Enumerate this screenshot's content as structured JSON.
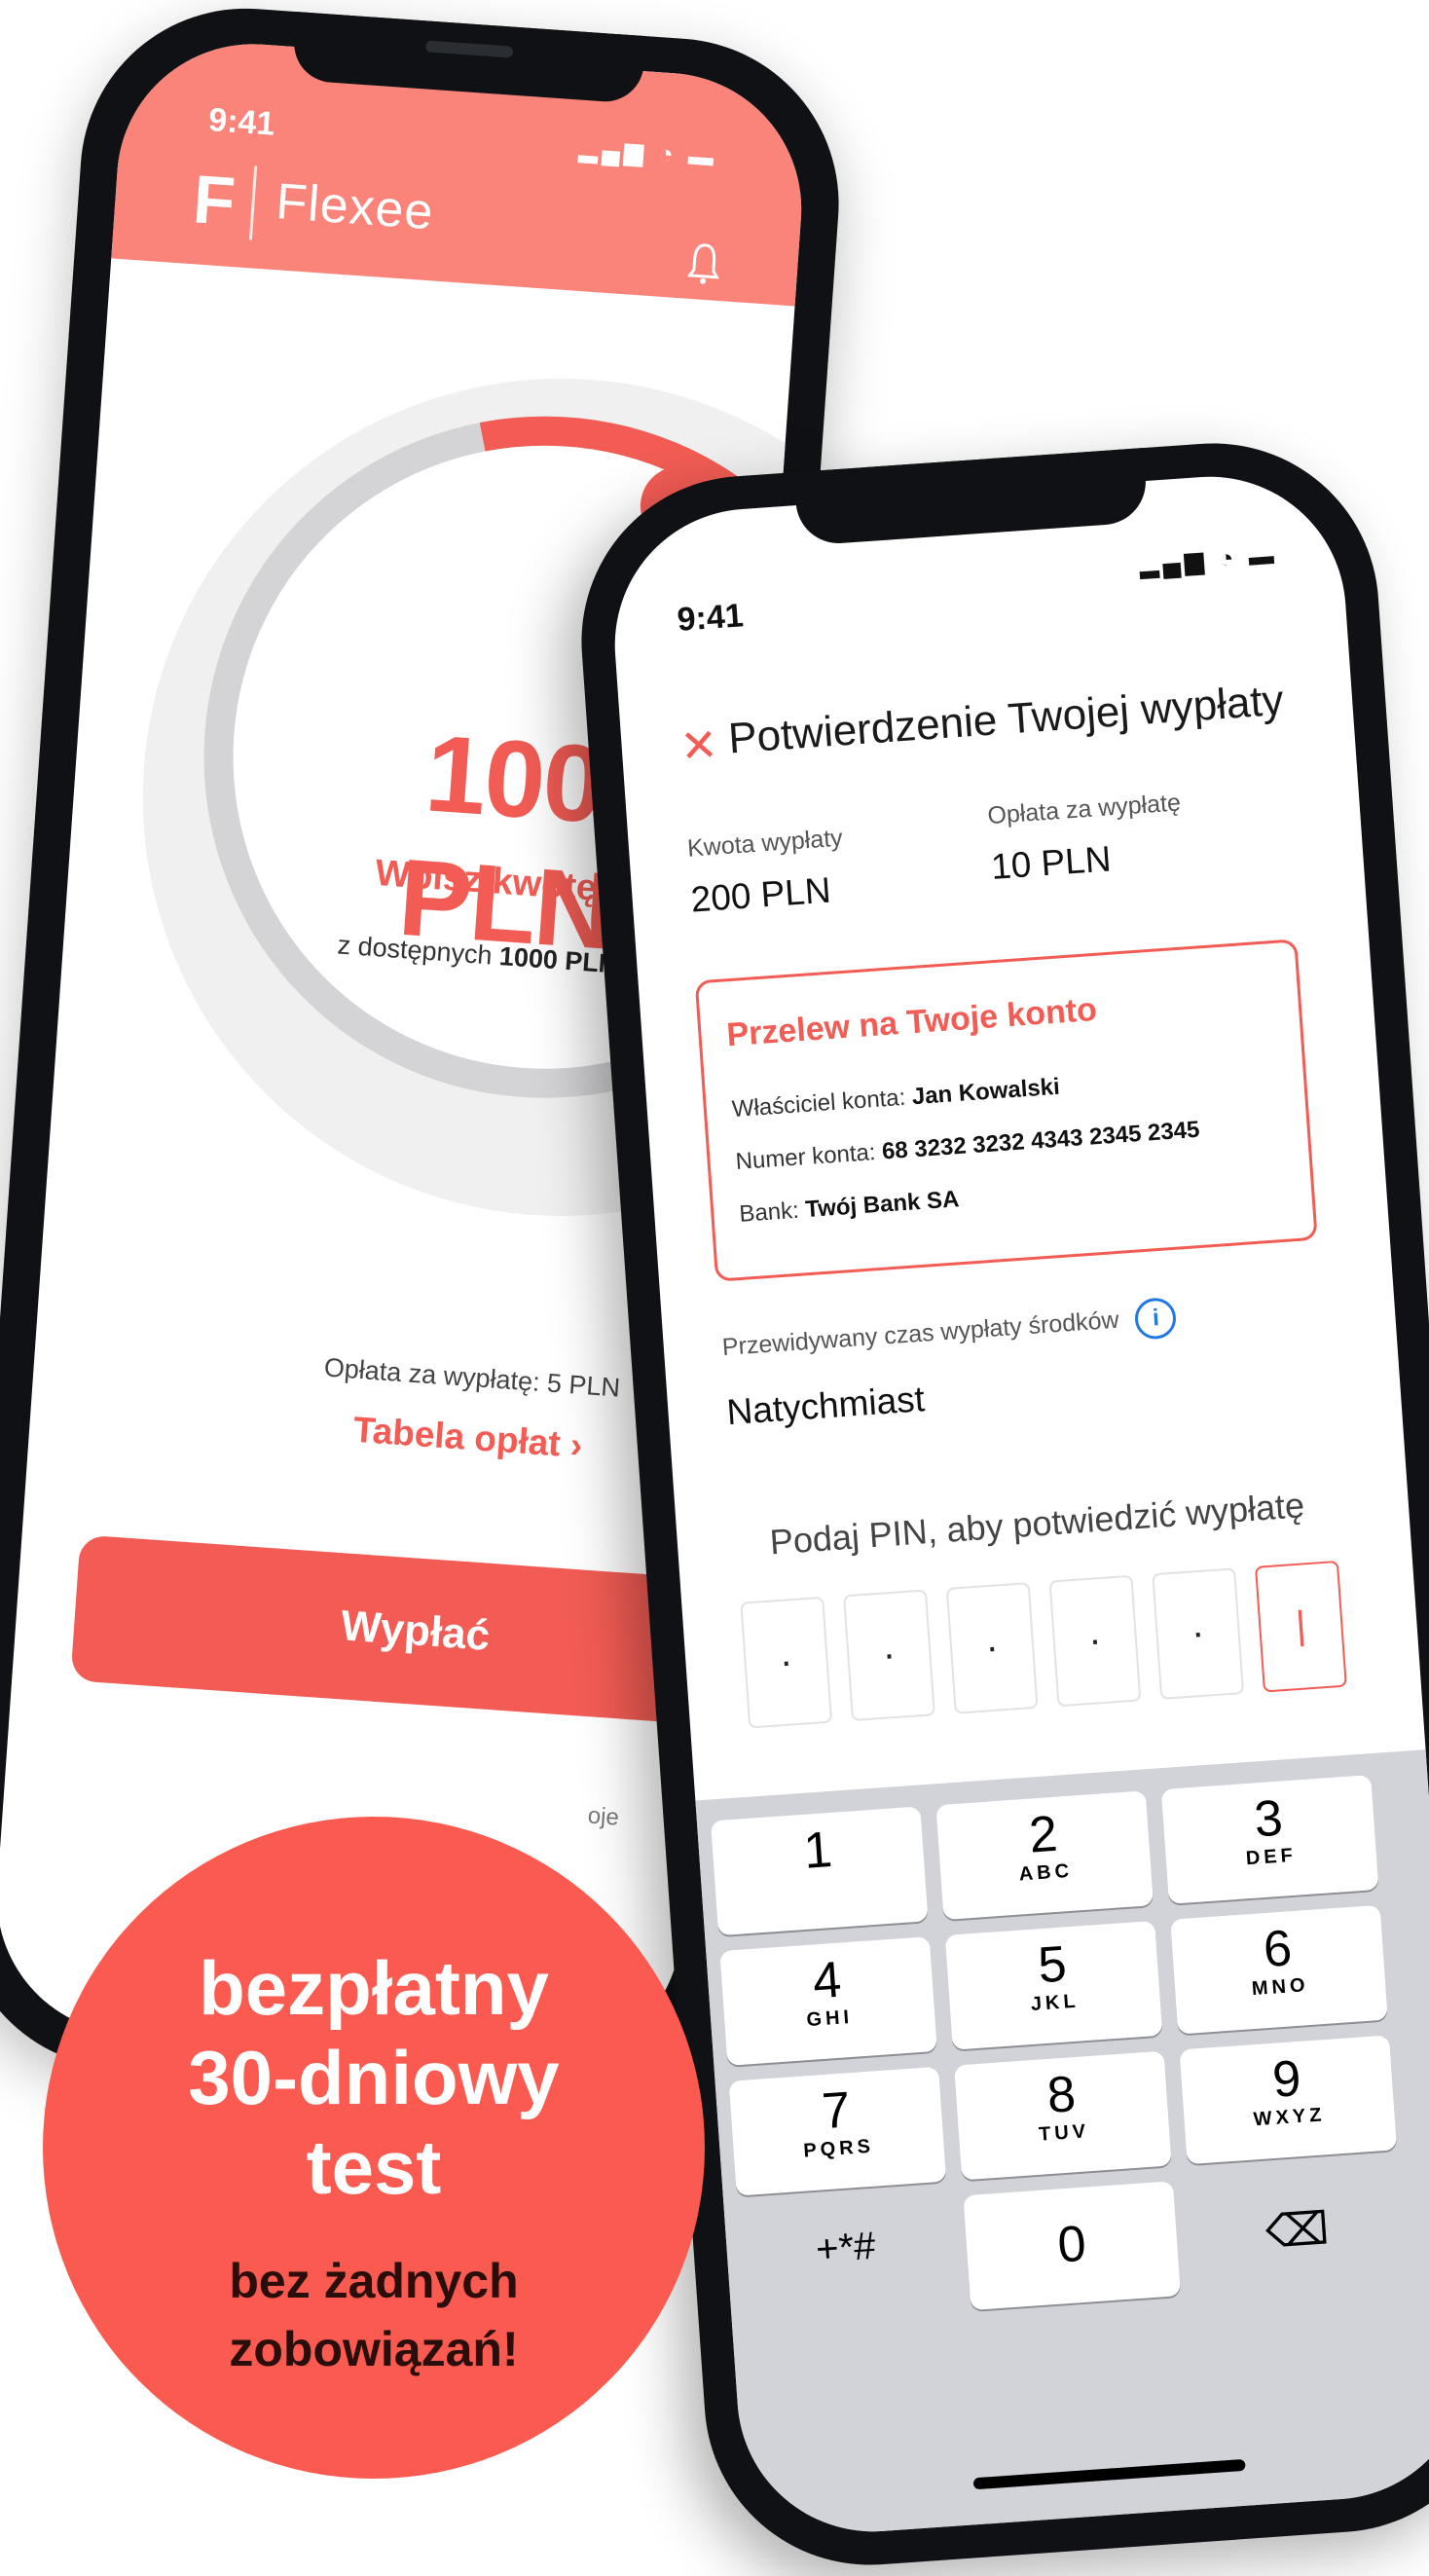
{
  "back_phone": {
    "time": "9:41",
    "status_icons": "▂▄▆ ◔ ▬",
    "logo_mark": "F",
    "brand": "Flexee",
    "amount": "100 PLN",
    "enter_amount_label": "Wpisz kwotę ✎",
    "available_prefix": "z dostępnych",
    "available_value": "1000 PLN",
    "info_symbol": "i",
    "fee_text": "Opłata za wypłatę: 5 PLN",
    "fee_table_link": "Tabela opłat ›",
    "withdraw_button": "Wypłać",
    "nav_partial_label": "oje",
    "dial_handle_symbol": "⌟",
    "accent_color": "#f25c54",
    "header_color": "#fa8479",
    "icons": [
      "bell-icon",
      "info-icon",
      "edit-icon",
      "chevron-right-icon"
    ]
  },
  "front_phone": {
    "time": "9:41",
    "status_icons": "▂▄▆ ◔ ▬",
    "close_symbol": "✕",
    "title": "Potwierdzenie Twojej wypłaty",
    "amount_label": "Kwota wypłaty",
    "amount_value": "200 PLN",
    "fee_label": "Opłata za wypłatę",
    "fee_value": "10 PLN",
    "transfer": {
      "title": "Przelew na Twoje konto",
      "owner_label": "Właściciel konta:",
      "owner_value": "Jan Kowalski",
      "account_label": "Numer konta:",
      "account_value": "68 3232 3232 4343 2345 2345",
      "bank_label": "Bank:",
      "bank_value": "Twój Bank SA"
    },
    "time_label": "Przewidywany czas wypłaty środków",
    "time_value": "Natychmiast",
    "pin_prompt": "Podaj PIN, aby potwiedzić wypłatę",
    "pin_digits": [
      "·",
      "·",
      "·",
      "·",
      "·",
      "|"
    ],
    "keypad": [
      {
        "digit": "1",
        "letters": ""
      },
      {
        "digit": "2",
        "letters": "ABC"
      },
      {
        "digit": "3",
        "letters": "DEF"
      },
      {
        "digit": "4",
        "letters": "GHI"
      },
      {
        "digit": "5",
        "letters": "JKL"
      },
      {
        "digit": "6",
        "letters": "MNO"
      },
      {
        "digit": "7",
        "letters": "PQRS"
      },
      {
        "digit": "8",
        "letters": "TUV"
      },
      {
        "digit": "9",
        "letters": "WXYZ"
      },
      {
        "digit": "0",
        "letters": ""
      }
    ],
    "symbols_key": "+*#",
    "backspace_symbol": "⌫",
    "icons": [
      "close-icon",
      "info-icon",
      "backspace-icon"
    ]
  },
  "badge": {
    "line1": "bezpłatny",
    "line2": "30-dniowy",
    "line3": "test",
    "sub1": "bez żadnych",
    "sub2": "zobowiązań!",
    "color": "#fa5a4f"
  }
}
